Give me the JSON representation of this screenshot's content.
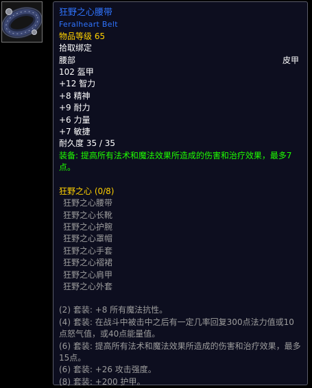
{
  "item": {
    "icon": "belt-icon",
    "name": "狂野之心腰带",
    "name_en": "Feralheart Belt",
    "item_level": "物品等级 65",
    "binding": "拾取绑定",
    "slot": "腰部",
    "armor_type": "皮甲",
    "armor": "102 盔甲",
    "stats": [
      "+12 智力",
      "+8 精神",
      "+9 耐力",
      "+6 力量",
      "+7 敏捷"
    ],
    "durability": "耐久度 35 / 35",
    "equip_effect": "装备: 提高所有法术和魔法效果所造成的伤害和治疗效果，最多7点。"
  },
  "set": {
    "name": "狂野之心 (0/8)",
    "pieces": [
      "狂野之心腰带",
      "狂野之心长靴",
      "狂野之心护腕",
      "狂野之心罩帽",
      "狂野之心手套",
      "狂野之心褶裙",
      "狂野之心肩甲",
      "狂野之心外套"
    ],
    "bonuses": [
      "(2) 套装: +8 所有魔法抗性。",
      "(4) 套装: 在战斗中被击中之后有一定几率回复300点法力值或10点怒气值，或40点能量值。",
      "(6) 套装: 提高所有法术和魔法效果所造成的伤害和治疗效果，最多15点。",
      "(6) 套装: +26 攻击强度。",
      "(8) 套装: +200 护甲。"
    ]
  },
  "colors": {
    "background": "#000000",
    "tooltip_bg": "#0d0e1f",
    "rare_blue": "#2f74ff",
    "gold": "#ffd100",
    "green": "#1eff00",
    "grey": "#9d9d9d",
    "white": "#ffffff"
  }
}
